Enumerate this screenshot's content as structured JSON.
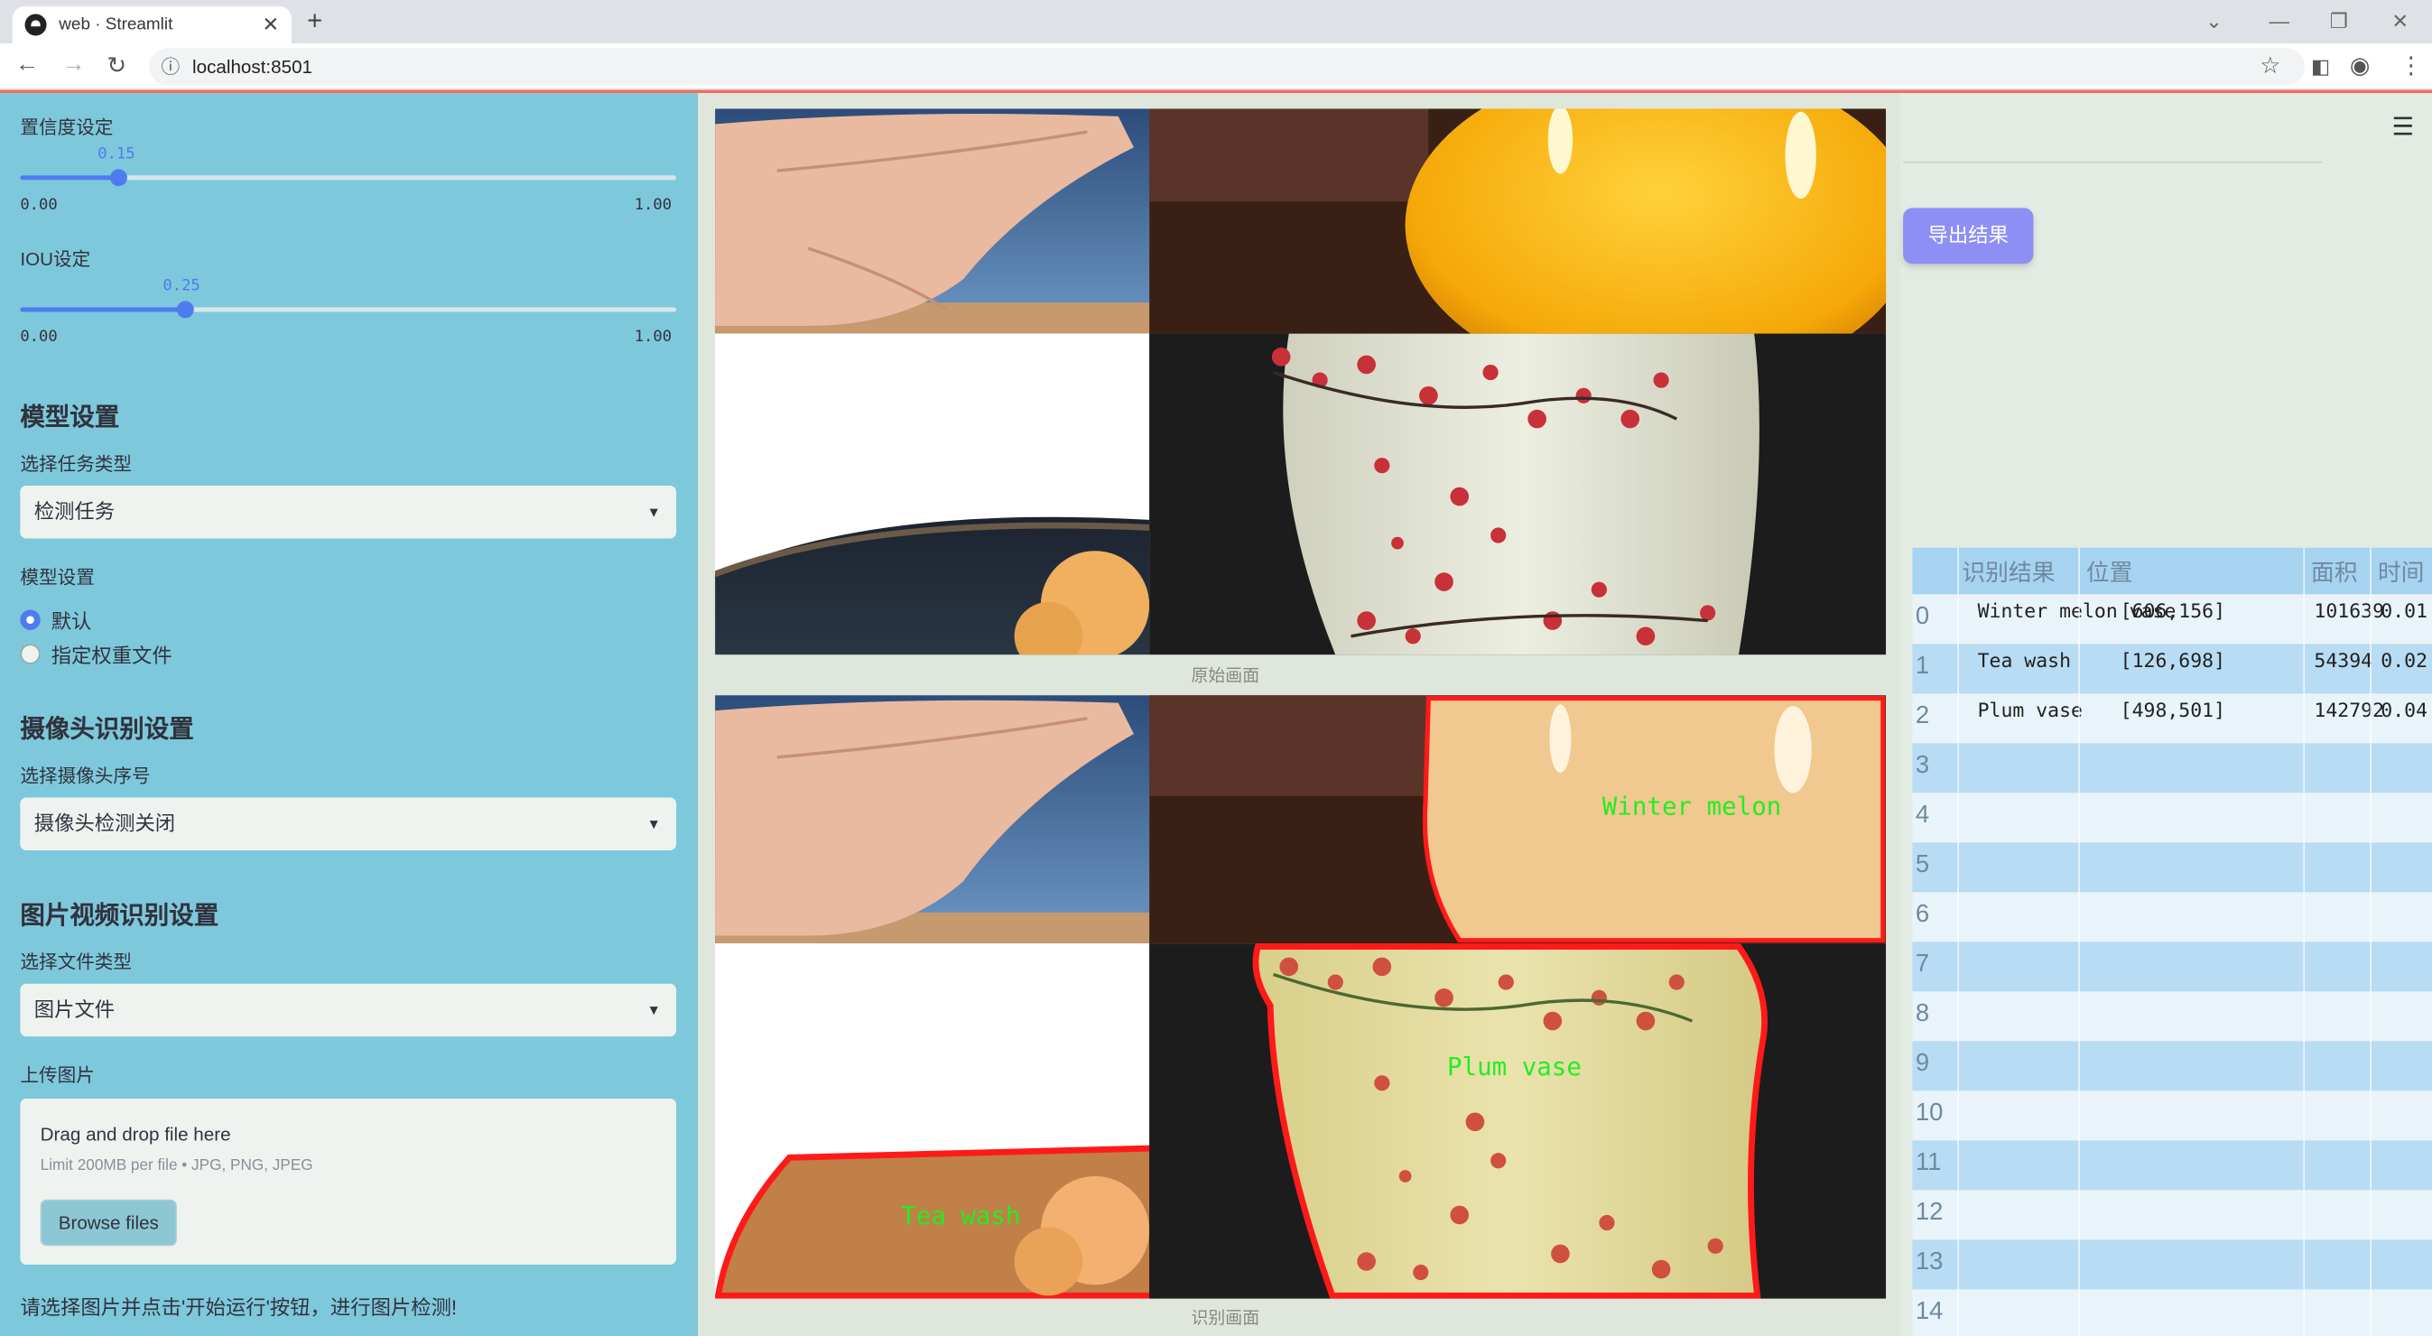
{
  "browser": {
    "tab_title": "web · Streamlit",
    "url": "localhost:8501"
  },
  "sidebar": {
    "confidence": {
      "label": "置信度设定",
      "value": "0.15",
      "min": "0.00",
      "max": "1.00",
      "fraction": 0.15
    },
    "iou": {
      "label": "IOU设定",
      "value": "0.25",
      "min": "0.00",
      "max": "1.00",
      "fraction": 0.25
    },
    "model_section": "模型设置",
    "task_label": "选择任务类型",
    "task_value": "检测任务",
    "model_label": "模型设置",
    "radio_default": "默认",
    "radio_custom": "指定权重文件",
    "camera_section": "摄像头识别设置",
    "camera_label": "选择摄像头序号",
    "camera_value": "摄像头检测关闭",
    "media_section": "图片视频识别设置",
    "filetype_label": "选择文件类型",
    "filetype_value": "图片文件",
    "upload_label": "上传图片",
    "upload_title": "Drag and drop file here",
    "upload_limit": "Limit 200MB per file • JPG, PNG, JPEG",
    "browse_label": "Browse files",
    "hint": "请选择图片并点击'开始运行'按钮，进行图片检测!"
  },
  "main": {
    "original_caption": "原始画面",
    "result_caption": "识别画面",
    "labels": {
      "melon": "Winter melon",
      "tea": "Tea wash",
      "plum": "Plum vase"
    }
  },
  "right": {
    "export_label": "导出结果",
    "table": {
      "headers": [
        "识别结果",
        "位置",
        "面积",
        "时间"
      ],
      "rows": [
        {
          "idx": "0",
          "name": "Winter melon vase",
          "pos": "[606,156]",
          "area": "101639",
          "time": "0.01"
        },
        {
          "idx": "1",
          "name": "Tea wash",
          "pos": "[126,698]",
          "area": "54394",
          "time": "0.02"
        },
        {
          "idx": "2",
          "name": "Plum vase",
          "pos": "[498,501]",
          "area": "142792",
          "time": "0.04"
        },
        {
          "idx": "3"
        },
        {
          "idx": "4"
        },
        {
          "idx": "5"
        },
        {
          "idx": "6"
        },
        {
          "idx": "7"
        },
        {
          "idx": "8"
        },
        {
          "idx": "9"
        },
        {
          "idx": "10"
        },
        {
          "idx": "11"
        },
        {
          "idx": "12"
        },
        {
          "idx": "13"
        },
        {
          "idx": "14"
        }
      ]
    }
  }
}
